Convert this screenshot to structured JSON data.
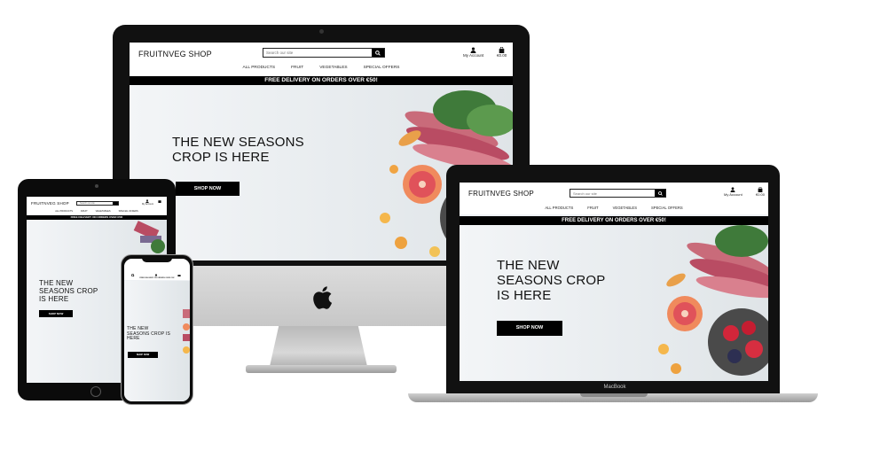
{
  "site": {
    "brand": "FRUITNVEG SHOP",
    "search_placeholder": "Search our site",
    "account_label": "My Account",
    "cart_total": "€0.00",
    "nav": [
      "ALL PRODUCTS",
      "FRUIT",
      "VEGETABLES",
      "SPECIAL OFFERS"
    ],
    "banner": "FREE DELIVERY ON ORDERS OVER €50!",
    "hero_title": "THE NEW SEASONS\nCROP IS HERE",
    "hero_title_laptop": "THE NEW\nSEASONS CROP\nIS HERE",
    "hero_title_tablet": "THE NEW\nSEASONS CROP\nIS HERE",
    "hero_title_phone": "THE NEW\nSEASONS CROP IS\nHERE",
    "cta": "SHOP NOW"
  },
  "devices": {
    "laptop_label": "MacBook"
  },
  "icons": {
    "search": "search-icon",
    "account": "user-icon",
    "cart": "shopping-bag-icon",
    "apple": "apple-logo-icon"
  },
  "colors": {
    "banner_bg": "#000000",
    "button_bg": "#000000",
    "hero_bg": "#eef1f4"
  }
}
